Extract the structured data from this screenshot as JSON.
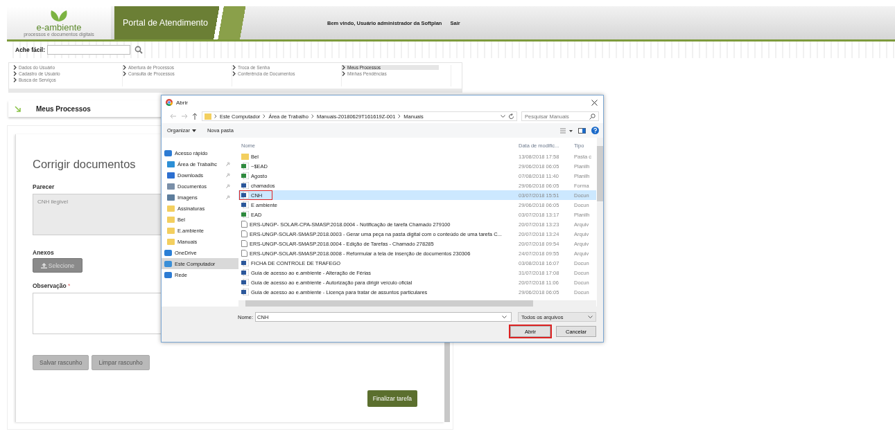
{
  "header": {
    "logo_text": "e-ambiente",
    "logo_tagline": "processos e documentos digitais",
    "portal_title": "Portal de Atendimento",
    "welcome": "Bem vindo, Usuário administrador da Softplan",
    "logout": "Sair"
  },
  "quick_search": {
    "label": "Ache fácil:"
  },
  "nav_columns": [
    [
      {
        "label": "Dados do Usuário",
        "selected": false
      },
      {
        "label": "Cadastro de Usuário",
        "selected": false
      },
      {
        "label": "Busca de Serviços",
        "selected": false
      }
    ],
    [
      {
        "label": "Abertura de Processos",
        "selected": false
      },
      {
        "label": "Consulta de Processos",
        "selected": false
      }
    ],
    [
      {
        "label": "Troca de Senha",
        "selected": false
      },
      {
        "label": "Conferência de Documentos",
        "selected": false
      }
    ],
    [
      {
        "label": "Meus Processos",
        "selected": true
      },
      {
        "label": "Minhas Pendências",
        "selected": false
      }
    ]
  ],
  "section_title": "Meus Processos",
  "form": {
    "title": "Corrigir documentos",
    "opinion_label": "Parecer",
    "opinion_value": "CNH ilegivel",
    "attachments_label": "Anexos",
    "upload_button": "Selecione",
    "note_label": "Observação",
    "note_required": "*",
    "draft_buttons": [
      "Salvar rascunho",
      "Limpar rascunho"
    ],
    "finish_button": "Finalizar tarefa"
  },
  "dialog": {
    "title": "Abrir",
    "path": [
      "Este Computador",
      "Área de Trabalho",
      "Manuais-20180629T161619Z-001",
      "Manuais"
    ],
    "search_placeholder": "Pesquisar Manuais",
    "toolbar": [
      "Organizar",
      "Nova pasta"
    ],
    "sidebar": [
      {
        "label": "Acesso rápido",
        "kind": "star",
        "selected": false,
        "children": [
          {
            "label": "Área de Trabalhc",
            "kind": "desktop",
            "pinned": true,
            "selected": false
          },
          {
            "label": "Downloads",
            "kind": "download",
            "pinned": true,
            "selected": false
          },
          {
            "label": "Documentos",
            "kind": "document",
            "pinned": true,
            "selected": false
          },
          {
            "label": "Imagens",
            "kind": "image",
            "pinned": true,
            "selected": false
          },
          {
            "label": "Assinaturas",
            "kind": "folder",
            "pinned": false,
            "selected": false
          },
          {
            "label": "Bel",
            "kind": "folder",
            "pinned": false,
            "selected": false
          },
          {
            "label": "E.ambiente",
            "kind": "folder",
            "pinned": false,
            "selected": false
          },
          {
            "label": "Manuais",
            "kind": "folder",
            "pinned": false,
            "selected": false
          }
        ]
      },
      {
        "label": "OneDrive",
        "kind": "cloud",
        "selected": false
      },
      {
        "label": "Este Computador",
        "kind": "computer",
        "selected": true
      },
      {
        "label": "Rede",
        "kind": "network",
        "selected": false
      }
    ],
    "columns": [
      "Nome",
      "Data de modific...",
      "Tipo"
    ],
    "files": [
      {
        "name": "Bel",
        "date": "13/08/2018 17:58",
        "type": "Pasta c",
        "kind": "folder",
        "selected": false,
        "highlighted": false
      },
      {
        "name": "~$EAD",
        "date": "29/06/2018 06:05",
        "type": "Planilh",
        "kind": "sheet",
        "selected": false,
        "highlighted": false
      },
      {
        "name": "Agosto",
        "date": "07/08/2018 11:40",
        "type": "Planilh",
        "kind": "sheet",
        "selected": false,
        "highlighted": false
      },
      {
        "name": "chamados",
        "date": "29/06/2018 06:05",
        "type": "Forma",
        "kind": "word",
        "selected": false,
        "highlighted": false
      },
      {
        "name": "CNH",
        "date": "03/07/2018 15:51",
        "type": "Docun",
        "kind": "word",
        "selected": true,
        "highlighted": true
      },
      {
        "name": "E ambiente",
        "date": "29/06/2018 06:05",
        "type": "Docun",
        "kind": "word",
        "selected": false,
        "highlighted": false
      },
      {
        "name": "EAD",
        "date": "03/07/2018 13:17",
        "type": "Planilh",
        "kind": "sheet",
        "selected": false,
        "highlighted": false
      },
      {
        "name": "ERS-UNGP- SOLAR-CPA-SMASP.2018.0004 - Notificação de tarefa Chamado 279100",
        "date": "20/07/2018 13:23",
        "type": "Arquiv",
        "kind": "generic",
        "selected": false,
        "highlighted": false
      },
      {
        "name": "ERS-UNGP-SOLAR-SMASP.2018.0003 - Gerar uma peça na pasta digital com o conteúdo de uma tarefa C...",
        "date": "20/07/2018 13:24",
        "type": "Arquiv",
        "kind": "generic",
        "selected": false,
        "highlighted": false
      },
      {
        "name": "ERS-UNGP-SOLAR-SMASP.2018.0004 - Edição de Tarefas - Chamado 278285",
        "date": "20/07/2018 09:54",
        "type": "Arquiv",
        "kind": "generic",
        "selected": false,
        "highlighted": false
      },
      {
        "name": "ERS-UNGP-SOLAR-SMASP.2018.0008 - Reformular a tela de inserção de documentos  230306",
        "date": "24/07/2018 09:55",
        "type": "Arquiv",
        "kind": "generic",
        "selected": false,
        "highlighted": false
      },
      {
        "name": "FICHA DE CONTROLE DE TRAFEGO",
        "date": "03/08/2018 16:07",
        "type": "Docun",
        "kind": "word",
        "selected": false,
        "highlighted": false
      },
      {
        "name": "Guia de acesso ao e.ambiente - Alteração de Férias",
        "date": "31/07/2018 17:08",
        "type": "Docun",
        "kind": "word",
        "selected": false,
        "highlighted": false
      },
      {
        "name": "Guia de acesso ao e.ambiente - Autorização para dirigir veículo oficial",
        "date": "20/07/2018 11:06",
        "type": "Docun",
        "kind": "word",
        "selected": false,
        "highlighted": false
      },
      {
        "name": "Guia de acesso ao e.ambiente - Licença para tratar de assuntos particulares",
        "date": "29/06/2018 06:05",
        "type": "Docun",
        "kind": "word",
        "selected": false,
        "highlighted": false
      }
    ],
    "filename_label": "Nome:",
    "filename": "CNH",
    "filter": "Todos os arquivos",
    "buttons": [
      {
        "label": "Abrir",
        "highlighted": true
      },
      {
        "label": "Cancelar",
        "highlighted": false
      }
    ]
  }
}
